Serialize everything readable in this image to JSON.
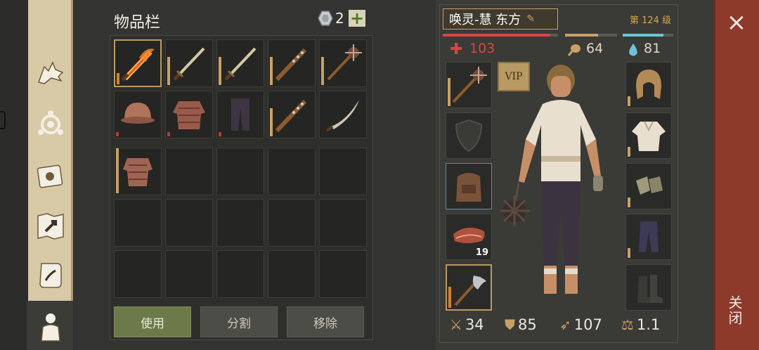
{
  "inventory": {
    "title": "物品栏",
    "gem_count": "2",
    "add_symbol": "+"
  },
  "buttons": {
    "use": "使用",
    "split": "分割",
    "remove": "移除"
  },
  "character": {
    "name": "唤灵-慧 东方",
    "level": "第 124 级",
    "health": "103",
    "food": "64",
    "water": "81",
    "vip": "VIP",
    "item_count": "19"
  },
  "stats": {
    "attack": "34",
    "defense": "85",
    "speed": "107",
    "weight": "1.1"
  },
  "close": {
    "label": "关闭",
    "symbol": "×"
  },
  "colors": {
    "health": "#d9453f",
    "food": "#c9a064",
    "water": "#6fc3d4",
    "accent": "#b99a62",
    "close_bg": "#8d3a2b"
  },
  "icons": {
    "rail": [
      "wolf-icon",
      "clan-icon",
      "journal-icon",
      "map-icon",
      "scroll-icon",
      "character-icon"
    ],
    "inventory_row1": [
      "flaming-sword-icon",
      "sword-icon",
      "sword-icon",
      "spiked-club-icon",
      "mace-icon"
    ],
    "inventory_row2": [
      "helmet-icon",
      "chainmail-icon",
      "leggings-icon",
      "spiked-club-icon",
      "scimitar-icon"
    ],
    "inventory_row3": [
      "chainmail-icon"
    ]
  }
}
